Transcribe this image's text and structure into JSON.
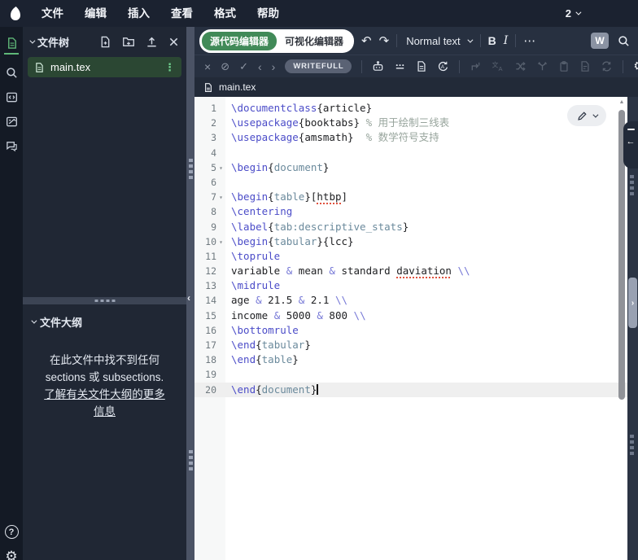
{
  "menubar": {
    "items": [
      "文件",
      "编辑",
      "插入",
      "查看",
      "格式",
      "帮助"
    ],
    "layout_switcher": "2"
  },
  "filetree": {
    "title": "文件树",
    "files": [
      {
        "name": "main.tex",
        "selected": true
      }
    ]
  },
  "outline": {
    "title": "文件大纲",
    "empty_message": "在此文件中找不到任何 sections 或 subsections. ",
    "learn_more": "了解有关文件大纲的更多信息"
  },
  "toolbar": {
    "editor_toggle": {
      "source": "源代码编辑器",
      "visual": "可视化编辑器",
      "active": "source"
    },
    "paragraph_style": "Normal text",
    "bold_label": "B",
    "italic_label": "I",
    "writefull_w": "W"
  },
  "writefull": {
    "badge": "WRITEFULL"
  },
  "tabbar": {
    "active_tab": "main.tex"
  },
  "icons": {
    "undo": "↶",
    "redo": "↷",
    "overflow": "⋯",
    "kebab": "⋮",
    "close": "×",
    "block": "⊘",
    "check": "✓",
    "prev": "‹",
    "next": "›",
    "gear": "⚙",
    "help": "?",
    "left_arrow": "←",
    "collapse_left": "‹",
    "scroll_up": "▲",
    "restore_chevron": "›"
  },
  "colors": {
    "topbar_bg": "#1b2230",
    "panel_bg": "#202734",
    "accent_green": "#418a58",
    "selected_file_bg": "#2b4733",
    "cmd_color": "#4b4cc8",
    "env_color": "#6b8a9c",
    "comment_color": "#97a49c",
    "error_underline": "#e0533f"
  },
  "editor": {
    "active_line": 20,
    "lines": [
      {
        "n": 1,
        "fold": false,
        "tokens": [
          {
            "s": "c",
            "t": "\\documentclass"
          },
          {
            "s": "t",
            "t": "{article}"
          }
        ]
      },
      {
        "n": 2,
        "fold": false,
        "tokens": [
          {
            "s": "c",
            "t": "\\usepackage"
          },
          {
            "s": "t",
            "t": "{booktabs}"
          },
          {
            "s": "m",
            "t": " % 用于绘制三线表"
          }
        ]
      },
      {
        "n": 3,
        "fold": false,
        "tokens": [
          {
            "s": "c",
            "t": "\\usepackage"
          },
          {
            "s": "t",
            "t": "{amsmath}"
          },
          {
            "s": "m",
            "t": "  % 数学符号支持"
          }
        ]
      },
      {
        "n": 4,
        "fold": false,
        "tokens": []
      },
      {
        "n": 5,
        "fold": true,
        "tokens": [
          {
            "s": "c",
            "t": "\\begin"
          },
          {
            "s": "t",
            "t": "{"
          },
          {
            "s": "e",
            "t": "document"
          },
          {
            "s": "t",
            "t": "}"
          }
        ]
      },
      {
        "n": 6,
        "fold": false,
        "tokens": []
      },
      {
        "n": 7,
        "fold": true,
        "tokens": [
          {
            "s": "c",
            "t": "\\begin"
          },
          {
            "s": "t",
            "t": "{"
          },
          {
            "s": "e",
            "t": "table"
          },
          {
            "s": "t",
            "t": "}["
          },
          {
            "s": "r",
            "t": "htbp"
          },
          {
            "s": "t",
            "t": "]"
          }
        ]
      },
      {
        "n": 8,
        "fold": false,
        "tokens": [
          {
            "s": "c",
            "t": "\\centering"
          }
        ]
      },
      {
        "n": 9,
        "fold": false,
        "tokens": [
          {
            "s": "c",
            "t": "\\label"
          },
          {
            "s": "t",
            "t": "{"
          },
          {
            "s": "e",
            "t": "tab:descriptive_stats"
          },
          {
            "s": "t",
            "t": "}"
          }
        ]
      },
      {
        "n": 10,
        "fold": true,
        "tokens": [
          {
            "s": "c",
            "t": "\\begin"
          },
          {
            "s": "t",
            "t": "{"
          },
          {
            "s": "e",
            "t": "tabular"
          },
          {
            "s": "t",
            "t": "}{lcc}"
          }
        ]
      },
      {
        "n": 11,
        "fold": false,
        "tokens": [
          {
            "s": "c",
            "t": "\\toprule"
          }
        ]
      },
      {
        "n": 12,
        "fold": false,
        "tokens": [
          {
            "s": "t",
            "t": "variable "
          },
          {
            "s": "a",
            "t": "&"
          },
          {
            "s": "t",
            "t": " mean "
          },
          {
            "s": "a",
            "t": "&"
          },
          {
            "s": "t",
            "t": " standard "
          },
          {
            "s": "r",
            "t": "daviation"
          },
          {
            "s": "t",
            "t": " "
          },
          {
            "s": "a",
            "t": "\\\\"
          }
        ]
      },
      {
        "n": 13,
        "fold": false,
        "tokens": [
          {
            "s": "c",
            "t": "\\midrule"
          }
        ]
      },
      {
        "n": 14,
        "fold": false,
        "tokens": [
          {
            "s": "t",
            "t": "age "
          },
          {
            "s": "a",
            "t": "&"
          },
          {
            "s": "t",
            "t": " 21.5 "
          },
          {
            "s": "a",
            "t": "&"
          },
          {
            "s": "t",
            "t": " 2.1 "
          },
          {
            "s": "a",
            "t": "\\\\"
          }
        ]
      },
      {
        "n": 15,
        "fold": false,
        "tokens": [
          {
            "s": "t",
            "t": "income "
          },
          {
            "s": "a",
            "t": "&"
          },
          {
            "s": "t",
            "t": " 5000 "
          },
          {
            "s": "a",
            "t": "&"
          },
          {
            "s": "t",
            "t": " 800 "
          },
          {
            "s": "a",
            "t": "\\\\"
          }
        ]
      },
      {
        "n": 16,
        "fold": false,
        "tokens": [
          {
            "s": "c",
            "t": "\\bottomrule"
          }
        ]
      },
      {
        "n": 17,
        "fold": false,
        "tokens": [
          {
            "s": "c",
            "t": "\\end"
          },
          {
            "s": "t",
            "t": "{"
          },
          {
            "s": "e",
            "t": "tabular"
          },
          {
            "s": "t",
            "t": "}"
          }
        ]
      },
      {
        "n": 18,
        "fold": false,
        "tokens": [
          {
            "s": "c",
            "t": "\\end"
          },
          {
            "s": "t",
            "t": "{"
          },
          {
            "s": "e",
            "t": "table"
          },
          {
            "s": "t",
            "t": "}"
          }
        ]
      },
      {
        "n": 19,
        "fold": false,
        "tokens": []
      },
      {
        "n": 20,
        "fold": false,
        "active": true,
        "cursor": true,
        "tokens": [
          {
            "s": "c",
            "t": "\\end"
          },
          {
            "s": "t",
            "t": "{"
          },
          {
            "s": "e",
            "t": "document"
          },
          {
            "s": "t",
            "t": "}"
          }
        ]
      }
    ]
  }
}
